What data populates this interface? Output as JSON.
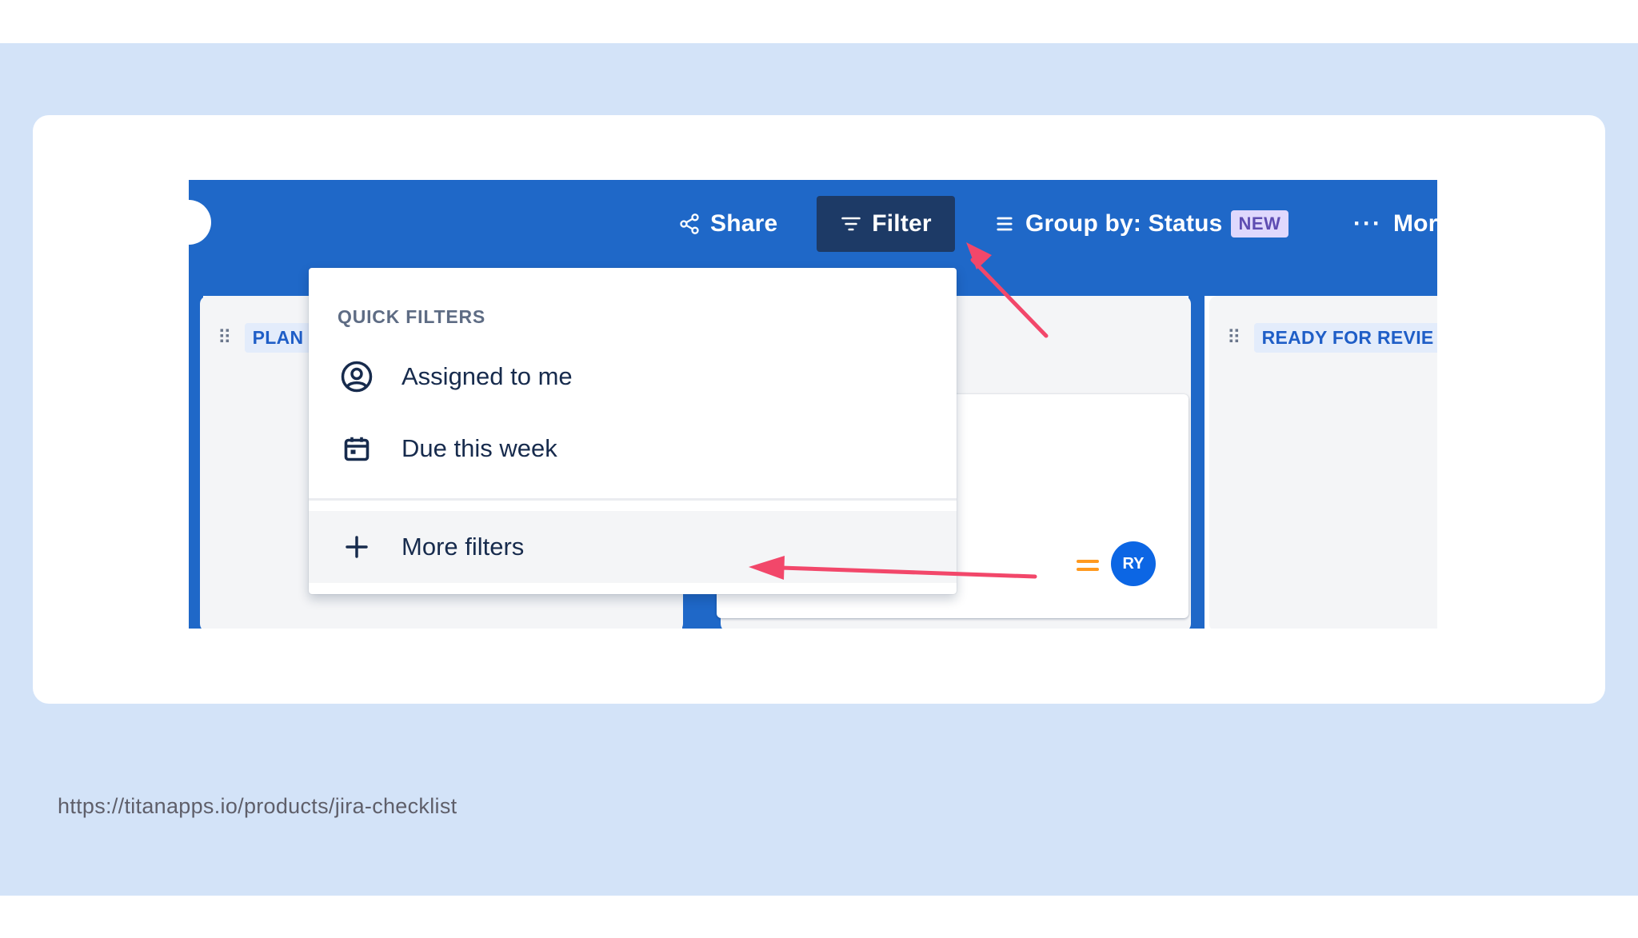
{
  "toolbar": {
    "share_label": "Share",
    "filter_label": "Filter",
    "group_by_label": "Group by: Status",
    "new_badge": "NEW",
    "more_label": "More"
  },
  "board": {
    "columns": [
      {
        "label": "PLAN"
      },
      {
        "label": "READY FOR REVIE"
      }
    ],
    "card": {
      "assignee_initials": "RY",
      "priority_color": "#ff991f"
    }
  },
  "quick_filters": {
    "heading": "QUICK FILTERS",
    "items": [
      {
        "label": "Assigned to me",
        "icon": "user-circle-icon"
      },
      {
        "label": "Due this week",
        "icon": "calendar-icon"
      }
    ],
    "more_filters_label": "More filters"
  },
  "colors": {
    "topbar": "#1f68c8",
    "filter_active": "#1d3a66",
    "annotation_arrow": "#f2476a",
    "slide_background": "#d3e3f8"
  },
  "footer": {
    "source_url": "https://titanapps.io/products/jira-checklist"
  }
}
